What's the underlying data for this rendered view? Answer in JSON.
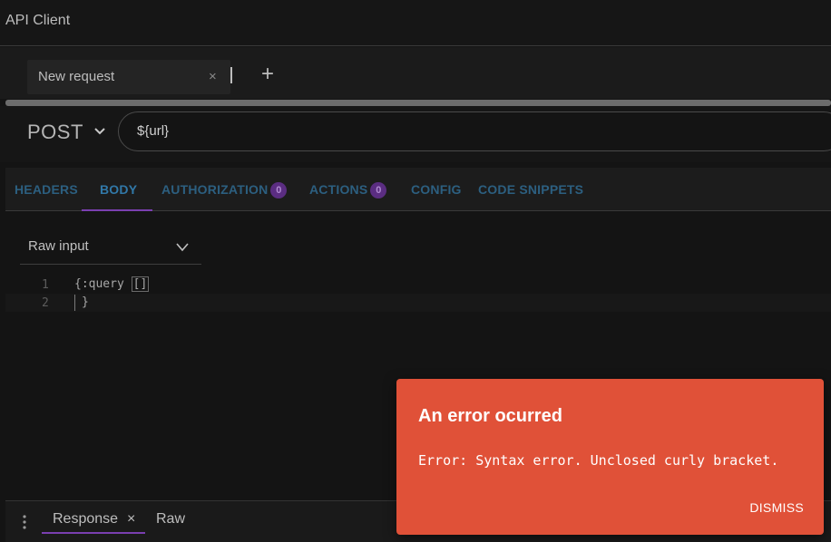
{
  "app": {
    "title": "API Client"
  },
  "tabs": [
    {
      "label": "New request",
      "close": "×"
    }
  ],
  "tabstrip": {
    "add": "+"
  },
  "request": {
    "method": "POST",
    "url": "${url}"
  },
  "section_tabs": [
    {
      "label": "Headers"
    },
    {
      "label": "Body",
      "active": true
    },
    {
      "label": "Authorization",
      "badge": "0"
    },
    {
      "label": "Actions",
      "badge": "0"
    },
    {
      "label": "Config"
    },
    {
      "label": "Code snippets"
    }
  ],
  "body": {
    "input_mode": "Raw input",
    "lines": [
      {
        "num": "1",
        "text_before": "{:query ",
        "bracket": "[]"
      },
      {
        "num": "2",
        "text": "}"
      }
    ]
  },
  "bottom": {
    "tabs": [
      {
        "label": "Response",
        "close": "×"
      },
      {
        "label": "Raw"
      }
    ]
  },
  "error_toast": {
    "title": "An error ocurred",
    "message": "Error: Syntax error. Unclosed curly bracket.",
    "dismiss": "DISMISS",
    "color": "#e05138"
  },
  "colors": {
    "accent": "#7a3fb0",
    "tab_text": "#3178a8",
    "background": "#141414"
  }
}
